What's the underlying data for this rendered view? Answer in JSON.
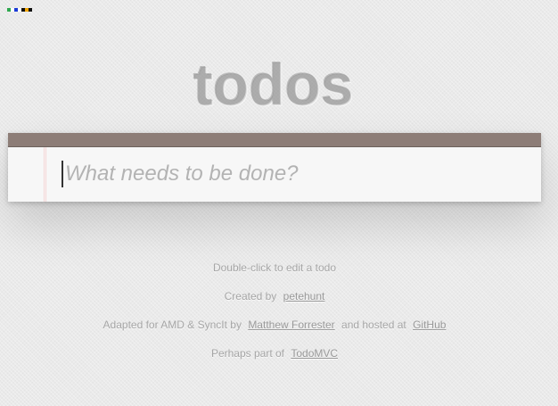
{
  "status_indicator": {
    "colors": [
      "#2fa84f",
      "#ffffff",
      "#1a3bd6",
      "#ffffff",
      "#111111",
      "#f2a500",
      "#111111"
    ]
  },
  "app": {
    "title": "todos",
    "new_todo_placeholder": "What needs to be done?",
    "new_todo_value": "",
    "header_bar_color": "#8d7d77"
  },
  "info": {
    "instructions": "Double-click to edit a todo",
    "created_by_prefix": "Created by",
    "created_by_link": "petehunt",
    "adapted_prefix": "Adapted for AMD & SyncIt by",
    "adapted_link": "Matthew Forrester",
    "hosted_prefix": "and hosted at",
    "hosted_link": "GitHub",
    "part_of_prefix": "Perhaps part of",
    "part_of_link": "TodoMVC"
  }
}
